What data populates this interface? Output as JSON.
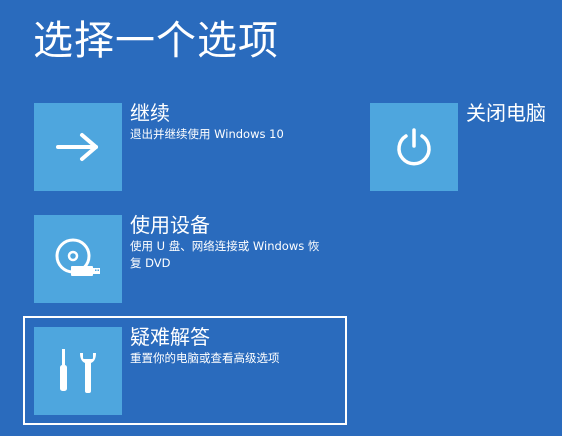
{
  "screen": {
    "title": "选择一个选项"
  },
  "options": [
    {
      "id": "continue",
      "title": "继续",
      "description": "退出并继续使用 Windows 10",
      "icon": "arrow-right-icon"
    },
    {
      "id": "use-device",
      "title": "使用设备",
      "description": "使用 U 盘、网络连接或 Windows 恢复 DVD",
      "icon": "disc-usb-icon"
    },
    {
      "id": "troubleshoot",
      "title": "疑难解答",
      "description": "重置你的电脑或查看高级选项",
      "icon": "tools-icon",
      "selected": true
    },
    {
      "id": "shutdown",
      "title": "关闭电脑",
      "description": "",
      "icon": "power-icon"
    }
  ],
  "colors": {
    "background": "#2a6bbd",
    "tile": "#4ea6de",
    "text": "#ffffff"
  }
}
